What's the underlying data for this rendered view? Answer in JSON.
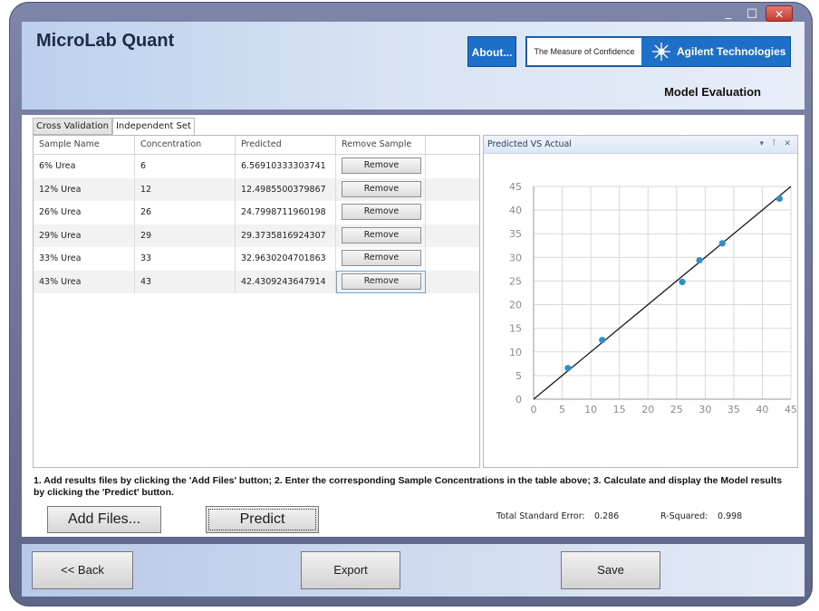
{
  "window": {
    "minimize_glyph": "_",
    "maximize_glyph": "□",
    "close_glyph": "✕"
  },
  "header": {
    "app_title": "MicroLab Quant",
    "about_label": "About...",
    "tagline": "The Measure of Confidence",
    "company": "Agilent Technologies",
    "subtitle": "Model Evaluation"
  },
  "tabs": [
    {
      "label": "Cross Validation",
      "active": false
    },
    {
      "label": "Independent Set",
      "active": true
    }
  ],
  "table": {
    "columns": [
      "Sample Name",
      "Concentration",
      "Predicted",
      "Remove Sample",
      ""
    ],
    "remove_label": "Remove",
    "rows": [
      {
        "name": "6% Urea",
        "concentration": "6",
        "predicted": "6.56910333303741"
      },
      {
        "name": "12% Urea",
        "concentration": "12",
        "predicted": "12.4985500379867"
      },
      {
        "name": "26% Urea",
        "concentration": "26",
        "predicted": "24.7998711960198"
      },
      {
        "name": "29% Urea",
        "concentration": "29",
        "predicted": "29.3735816924307"
      },
      {
        "name": "33% Urea",
        "concentration": "33",
        "predicted": "32.9630204701863"
      },
      {
        "name": "43% Urea",
        "concentration": "43",
        "predicted": "42.4309243647914"
      }
    ]
  },
  "chart_panel": {
    "title": "Predicted VS Actual",
    "tools": "▾ ⊺ ✕"
  },
  "chart_data": {
    "type": "scatter",
    "title": "Predicted VS Actual",
    "xlabel": "",
    "ylabel": "",
    "xlim": [
      0,
      45
    ],
    "ylim": [
      0,
      45
    ],
    "xticks": [
      0,
      5,
      10,
      15,
      20,
      25,
      30,
      35,
      40,
      45
    ],
    "yticks": [
      0,
      5,
      10,
      15,
      20,
      25,
      30,
      35,
      40,
      45
    ],
    "grid": true,
    "points": [
      {
        "x": 6,
        "y": 6.57
      },
      {
        "x": 12,
        "y": 12.5
      },
      {
        "x": 26,
        "y": 24.8
      },
      {
        "x": 29,
        "y": 29.37
      },
      {
        "x": 33,
        "y": 32.96
      },
      {
        "x": 43,
        "y": 42.43
      }
    ],
    "fit_line": {
      "x": [
        0,
        45
      ],
      "y": [
        0,
        45
      ]
    },
    "colors": {
      "point": "#2f8fc6",
      "line": "#1a1a1a",
      "grid": "#d9d9d9"
    }
  },
  "instructions": "1. Add results files by clicking the 'Add Files' button; 2. Enter the corresponding Sample Concentrations in the table above; 3. Calculate and display the Model results by clicking the 'Predict' button.",
  "actions": {
    "add_files": "Add Files...",
    "predict": "Predict"
  },
  "stats": {
    "tse_label": "Total Standard Error:",
    "tse_value": "0.286",
    "r2_label": "R-Squared:",
    "r2_value": "0.998"
  },
  "footer": {
    "back": "<< Back",
    "export": "Export",
    "save": "Save"
  }
}
